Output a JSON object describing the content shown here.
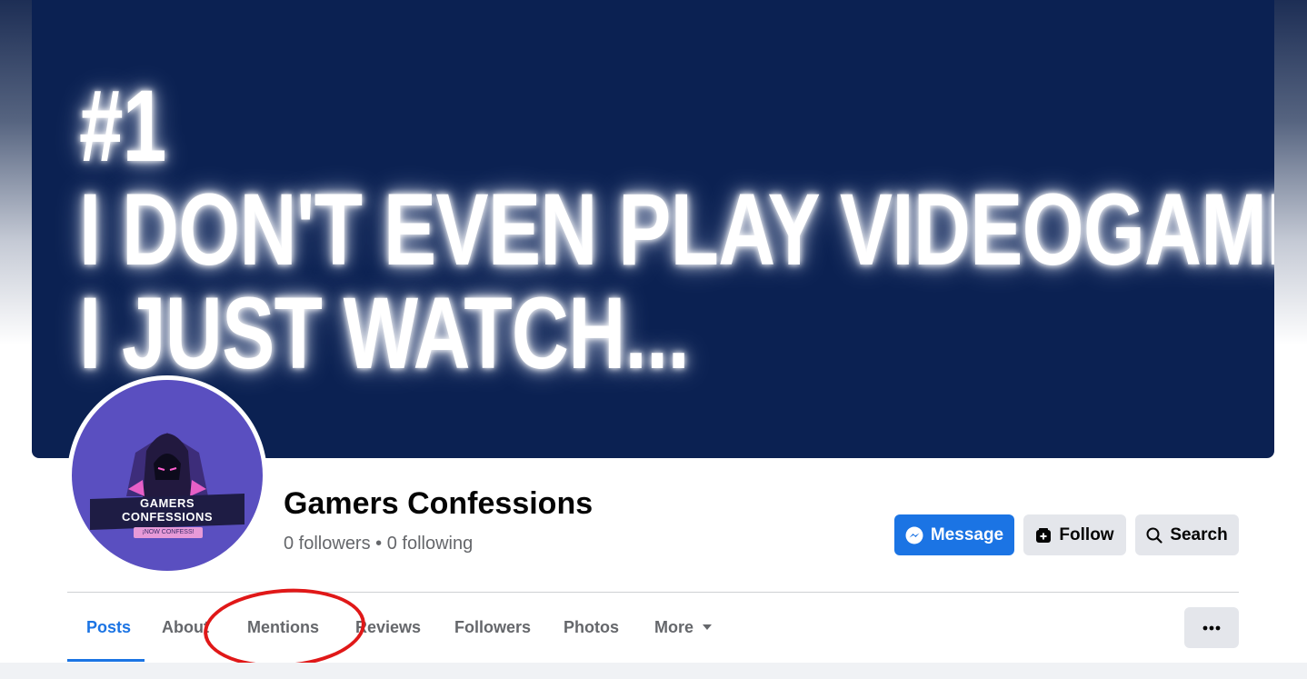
{
  "cover": {
    "lines": [
      "#1",
      "I DON'T EVEN PLAY VIDEOGAMES,",
      "I JUST WATCH..."
    ]
  },
  "profile": {
    "logo_line1": "GAMERS",
    "logo_line2": "CONFESSIONS",
    "logo_tagline": "¡NOW CONFESS!",
    "name": "Gamers Confessions",
    "stats": "0 followers • 0 following"
  },
  "actions": {
    "message_label": "Message",
    "follow_label": "Follow",
    "search_label": "Search"
  },
  "tabs": [
    {
      "label": "Posts"
    },
    {
      "label": "About"
    },
    {
      "label": "Mentions"
    },
    {
      "label": "Reviews"
    },
    {
      "label": "Followers"
    },
    {
      "label": "Photos"
    },
    {
      "label": "More"
    }
  ],
  "colors": {
    "brand": "#1b74e4",
    "cover_bg": "#0b2152",
    "annotation": "#e01818"
  }
}
